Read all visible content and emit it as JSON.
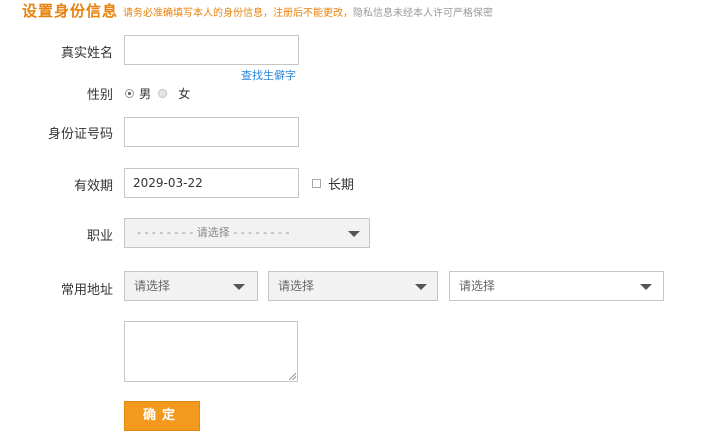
{
  "header": {
    "title": "设置身份信息",
    "notice_required": "请务必准确填写本人的身份信息，注册后不能更改，",
    "notice_privacy": "隐私信息未经本人许可严格保密"
  },
  "form": {
    "real_name": {
      "label": "真实姓名",
      "value": "",
      "rare_char_link": "查找生僻字"
    },
    "gender": {
      "label": "性别",
      "options": [
        {
          "label": "男",
          "selected": true
        },
        {
          "label": "女",
          "selected": false
        }
      ]
    },
    "id_number": {
      "label": "身份证号码",
      "value": ""
    },
    "validity": {
      "label": "有效期",
      "value": "2029-03-22",
      "long_term_label": "长期",
      "long_term_checked": false
    },
    "occupation": {
      "label": "职业",
      "selected": "- - - - - - - - 请选择 - - - - - - - -"
    },
    "address": {
      "label": "常用地址",
      "province": "请选择",
      "city": "请选择",
      "district": "请选择",
      "detail": ""
    },
    "submit_label": "确定"
  },
  "colors": {
    "accent": "#e8820c",
    "link": "#2a86d8",
    "button": "#f39a1e"
  }
}
